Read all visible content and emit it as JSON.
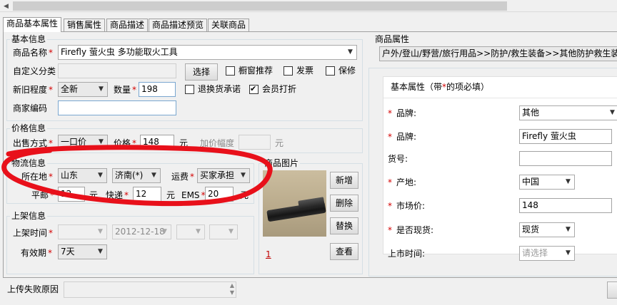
{
  "tabs": [
    "商品基本属性",
    "销售属性",
    "商品描述",
    "商品描述预览",
    "关联商品"
  ],
  "basic": {
    "legend": "基本信息",
    "name_label": "商品名称",
    "name_value": "Firefly 萤火虫 多功能取火工具",
    "custom_category_label": "自定义分类",
    "select_button": "选择",
    "checkbox_window": "橱窗推荐",
    "checkbox_invoice": "发票",
    "checkbox_warranty": "保修",
    "condition_label": "新旧程度",
    "condition_value": "全新",
    "quantity_label": "数量",
    "quantity_value": "198",
    "checkbox_return": "退换货承诺",
    "checkbox_member": "会员打折",
    "merchant_code_label": "商家编码",
    "merchant_code_value": ""
  },
  "price": {
    "legend": "价格信息",
    "sale_method_label": "出售方式",
    "sale_method_value": "一口价",
    "price_label": "价格",
    "price_value": "148",
    "unit": "元",
    "increment_label": "加价幅度",
    "increment_unit": "元"
  },
  "logistics": {
    "legend": "物流信息",
    "location_label": "所在地",
    "province": "山东",
    "city": "济南(*)",
    "freight_label": "运费",
    "freight_value": "买家承担",
    "mail_label": "平邮",
    "mail_value": "12",
    "mail_unit": "元",
    "express_label": "快递",
    "express_value": "12",
    "express_unit": "元",
    "ems_label": "EMS",
    "ems_value": "20",
    "ems_unit": "元"
  },
  "listing": {
    "legend": "上架信息",
    "time_label": "上架时间",
    "date_value": "2012-12-18",
    "validity_label": "有效期",
    "validity_value": "7天"
  },
  "images": {
    "legend": "商品图片",
    "add_button": "新增",
    "delete_button": "删除",
    "replace_button": "替换",
    "view_button": "查看",
    "index_link": "1"
  },
  "upload_fail_label": "上传失败原因",
  "properties": {
    "legend": "商品属性",
    "category_path": "户外/登山/野营/旅行用品>>防护/救生装备>>其他防护救生装备",
    "header": "基本属性（带",
    "header_suffix": "的项必填）",
    "rows": [
      {
        "label": "品牌:",
        "required": true,
        "type": "select",
        "value": "其他"
      },
      {
        "label": "品牌:",
        "required": true,
        "type": "input",
        "value": "Firefly 萤火虫"
      },
      {
        "label": "货号:",
        "required": false,
        "type": "input",
        "value": ""
      },
      {
        "label": "产地:",
        "required": true,
        "type": "select",
        "value": "中国"
      },
      {
        "label": "市场价:",
        "required": true,
        "type": "input",
        "value": "148"
      },
      {
        "label": "是否现货:",
        "required": true,
        "type": "select",
        "value": "现货"
      },
      {
        "label": "上市时间:",
        "required": false,
        "type": "select",
        "value": "请选择"
      }
    ]
  },
  "colors": {
    "required_star": "#d40000",
    "annotation_red": "#e8101a",
    "link_red": "#c00000"
  }
}
